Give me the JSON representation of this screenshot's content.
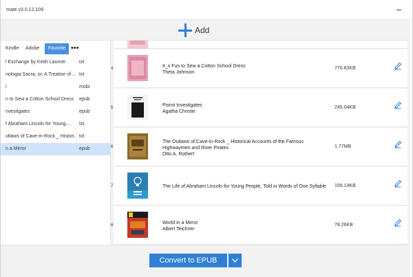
{
  "window": {
    "title": "mate v3.0.12.109"
  },
  "toolbar": {
    "add_label": "Add"
  },
  "left_panel": {
    "tabs": [
      {
        "label": "Kindle",
        "active": false
      },
      {
        "label": "Adobe",
        "active": false
      },
      {
        "label": "Favorite",
        "active": true
      }
    ],
    "more_label": "•••",
    "items": [
      {
        "name": "l Exchange by Keith Laumer",
        "format": "txt",
        "selected": false
      },
      {
        "name": "nologia Sacra; or, A Treatise of ...",
        "format": "txt",
        "selected": false
      },
      {
        "name": "i",
        "format": "mobi",
        "selected": false
      },
      {
        "name": "n to Sew a Cotton School Dress",
        "format": "epub",
        "selected": false
      },
      {
        "name": "nvestigates",
        "format": "epub",
        "selected": false
      },
      {
        "name": "f Abraham Lincoln for Young...",
        "format": "txt",
        "selected": false
      },
      {
        "name": "utlaws of Cave-in-Rock _ Histori...",
        "format": "txt",
        "selected": false
      },
      {
        "name": "n a Mirror",
        "format": "epub",
        "selected": true
      }
    ]
  },
  "books": [
    {
      "index": "4",
      "title": "It_s Fun to Sew a Cotton School Dress",
      "author": "Theta Johnson",
      "size": "770.83KB",
      "cover_color": "#e8a0b4"
    },
    {
      "index": "5",
      "title": "Poirot Investigates",
      "author": "Agatha Christie",
      "size": "245.04KB",
      "cover_color": "#1a1a1a"
    },
    {
      "index": "6",
      "title": "The Outlaws of Cave-in-Rock _ Historical Accounts of the Famous Highwaymen and River Pirates",
      "author": "Otto A. Rothert",
      "size": "1.77MB",
      "cover_color": "#8a6a2a"
    },
    {
      "index": "7",
      "title": "The Life of Abraham Lincoln for Young People, Told in Words of One Syllable",
      "author": "",
      "size": "156.14KB",
      "cover_color": "#2a7fb5",
      "cover_text": "Title\nAuthor"
    },
    {
      "index": "8",
      "title": "World in a Mirror",
      "author": "Albert Teichner",
      "size": "78.26KB",
      "cover_color": "#c0392b"
    }
  ],
  "bottom": {
    "convert_label": "Convert to EPUB"
  },
  "colors": {
    "accent": "#2f7fd6",
    "selected_row": "#cfe4fb"
  }
}
